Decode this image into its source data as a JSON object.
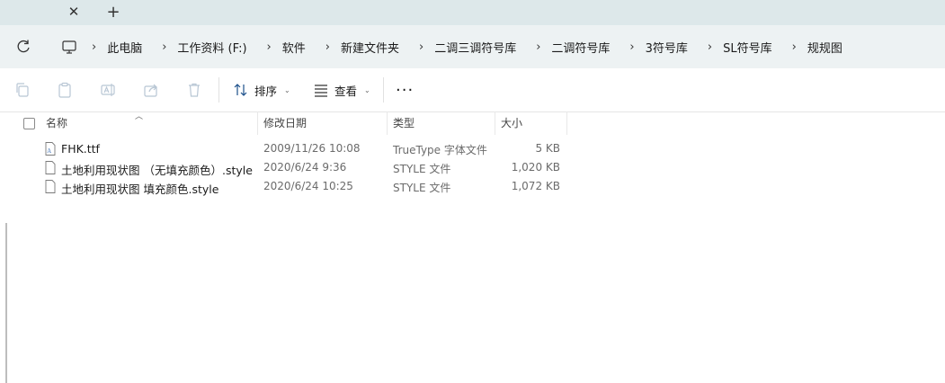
{
  "tabs": {
    "close_label": "✕",
    "new_label": "+"
  },
  "breadcrumb": {
    "separator": "›",
    "items": [
      "此电脑",
      "工作资料 (F:)",
      "软件",
      "新建文件夹",
      "二调三调符号库",
      "二调符号库",
      "3符号库",
      "SL符号库",
      "规规图"
    ]
  },
  "toolbar": {
    "sort_label": "排序",
    "view_label": "查看",
    "more_label": "···",
    "chevron": "⌄"
  },
  "columns": {
    "name": "名称",
    "date": "修改日期",
    "type": "类型",
    "size": "大小"
  },
  "files": [
    {
      "name": "FHK.ttf",
      "date": "2009/11/26 10:08",
      "type": "TrueType 字体文件",
      "size": "5 KB",
      "icon": "font-file-icon"
    },
    {
      "name": "土地利用现状图 （无填充颜色）.style",
      "date": "2020/6/24 9:36",
      "type": "STYLE 文件",
      "size": "1,020 KB",
      "icon": "file-icon"
    },
    {
      "name": "土地利用现状图 填充颜色.style",
      "date": "2020/6/24 10:25",
      "type": "STYLE 文件",
      "size": "1,072 KB",
      "icon": "file-icon"
    }
  ],
  "colors": {
    "tabstrip": "#dde8ea",
    "addressbar": "#edf2f3",
    "toolbar_disabled_icon": "#b8c6d4"
  }
}
